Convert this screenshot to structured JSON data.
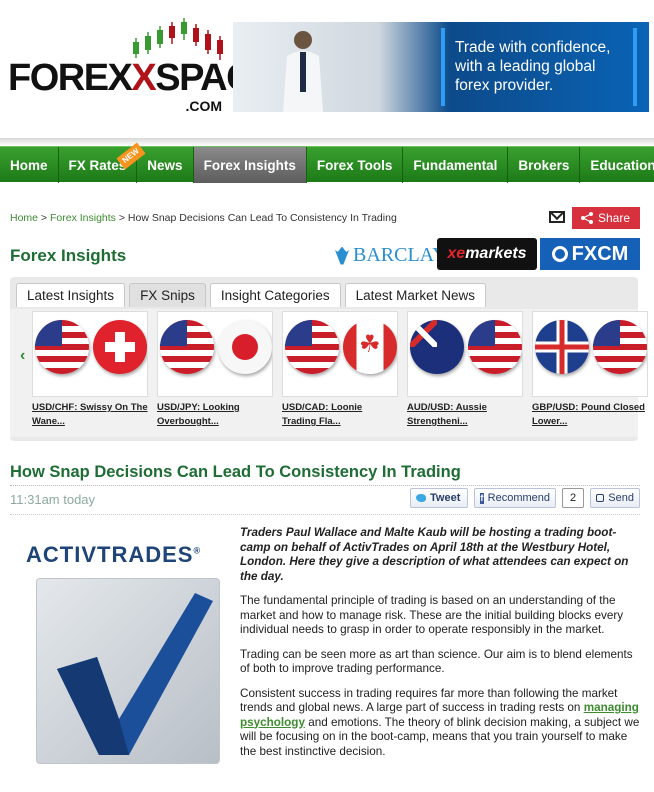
{
  "logo": {
    "forex": "FOREX",
    "x": "X",
    "space": "SPACE",
    "com": ".COM"
  },
  "ad": {
    "text": "Trade with confidence, with a leading global forex provider."
  },
  "nav": [
    {
      "label": "Home"
    },
    {
      "label": "FX Rates",
      "badge": "NEW"
    },
    {
      "label": "News"
    },
    {
      "label": "Forex Insights",
      "active": true
    },
    {
      "label": "Forex Tools"
    },
    {
      "label": "Fundamental"
    },
    {
      "label": "Brokers"
    },
    {
      "label": "Education"
    }
  ],
  "breadcrumb": {
    "home": "Home",
    "sep1": " > ",
    "section": "Forex Insights",
    "sep2": " > ",
    "current": "How Snap Decisions Can Lead To Consistency In Trading"
  },
  "share": {
    "label": "Share"
  },
  "insights": {
    "title": "Forex Insights"
  },
  "sponsors": {
    "barclays": "BARCLAYS",
    "xe": "xe",
    "markets": "markets",
    "fxcm": "FXCM"
  },
  "tabs": [
    {
      "label": "Latest Insights"
    },
    {
      "label": "FX Snips",
      "active": true
    },
    {
      "label": "Insight Categories"
    },
    {
      "label": "Latest Market News"
    }
  ],
  "carousel": {
    "prev": "‹",
    "next": "›",
    "cards": [
      {
        "caption": "USD/CHF: Swissy On The Wane...",
        "flags": [
          "us",
          "ch"
        ]
      },
      {
        "caption": "USD/JPY: Looking Overbought...",
        "flags": [
          "us",
          "jp"
        ]
      },
      {
        "caption": "USD/CAD: Loonie Trading Fla...",
        "flags": [
          "us",
          "ca"
        ]
      },
      {
        "caption": "AUD/USD: Aussie Strengtheni...",
        "flags": [
          "au",
          "us"
        ]
      },
      {
        "caption": "GBP/USD: Pound Closed Lower...",
        "flags": [
          "uk",
          "us"
        ]
      }
    ]
  },
  "article": {
    "title": "How Snap Decisions Can Lead To Consistency In Trading",
    "timestamp": "11:31am today",
    "lead": "Traders Paul Wallace and Malte Kaub will be hosting a trading boot-camp on behalf of ActivTrades on April 18th at the Westbury Hotel, London. Here they give a description of what attendees can expect on the day.",
    "p1": "The fundamental principle of trading is based on an understanding of the market and how to manage risk. These are the initial building blocks every individual needs to grasp in order to operate responsibly in the market.",
    "p2": "Trading can be seen more as art than science. Our aim is to blend elements of both to improve trading performance.",
    "p3_before": "Consistent success in trading requires far more than following the market trends and global news. A large part of success in trading rests on ",
    "p3_link": "managing psychology",
    "p3_after": " and emotions. The theory of blink decision making, a subject we will be focusing on in the boot-camp, means that you train yourself to make the best instinctive decision."
  },
  "social": {
    "tweet": "Tweet",
    "recommend": "Recommend",
    "count": "2",
    "send": "Send"
  },
  "activtrades": {
    "logo": "ACTIVTRADES",
    "reg": "®"
  },
  "colors": {
    "nav_green": "#2a8f22",
    "title_green": "#1e6d34",
    "share_red": "#d7313e",
    "fxcm_blue": "#1661b8"
  }
}
